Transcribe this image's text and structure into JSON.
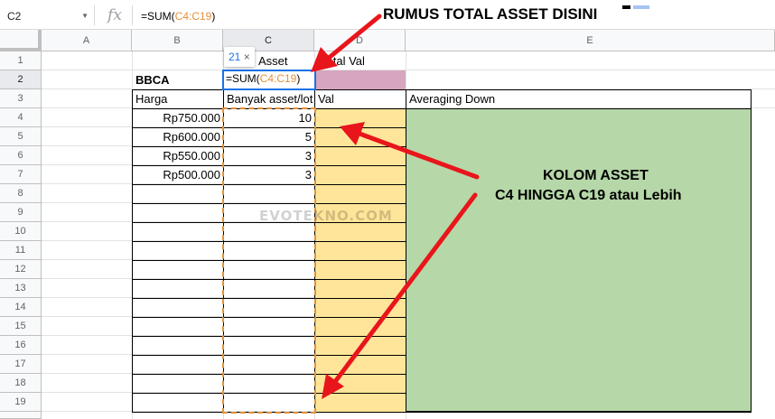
{
  "formula_bar": {
    "name_box": "C2",
    "fx_label": "fx",
    "formula_prefix": "=SUM(",
    "formula_range": "C4:C19",
    "formula_suffix": ")"
  },
  "columns": [
    "A",
    "B",
    "C",
    "D",
    "E"
  ],
  "rows": [
    "1",
    "2",
    "3",
    "4",
    "5",
    "6",
    "7",
    "8",
    "9",
    "10",
    "11",
    "12",
    "13",
    "14",
    "15",
    "16",
    "17",
    "18",
    "19"
  ],
  "cells": {
    "c1": "Asset",
    "d1": "Total Val",
    "b2": "BBCA",
    "b3": "Harga",
    "c3": "Banyak asset/lot",
    "d3": "Val",
    "e3": "Averaging Down",
    "b4": "Rp750.000",
    "b5": "Rp600.000",
    "b6": "Rp550.000",
    "b7": "Rp500.000",
    "c4": "10",
    "c5": "5",
    "c6": "3",
    "c7": "3"
  },
  "active_cell": {
    "prefix": "=SUM(",
    "range": "C4:C19",
    "suffix": ")"
  },
  "tooltip": {
    "value": "21",
    "close": "×"
  },
  "annotations": {
    "top": "RUMUS TOTAL ASSET DISINI",
    "right_line1": "KOLOM ASSET",
    "right_line2": "C4 HINGGA C19 atau Lebih"
  },
  "watermark": "EVOTEKNO.COM",
  "colors": {
    "pink_fill": "#d5a6bd",
    "yellow_fill": "#ffe599",
    "green_fill": "#b6d7a8",
    "range_highlight": "#e69138",
    "active_border": "#1a73e8",
    "arrow_red": "#e8151b"
  }
}
